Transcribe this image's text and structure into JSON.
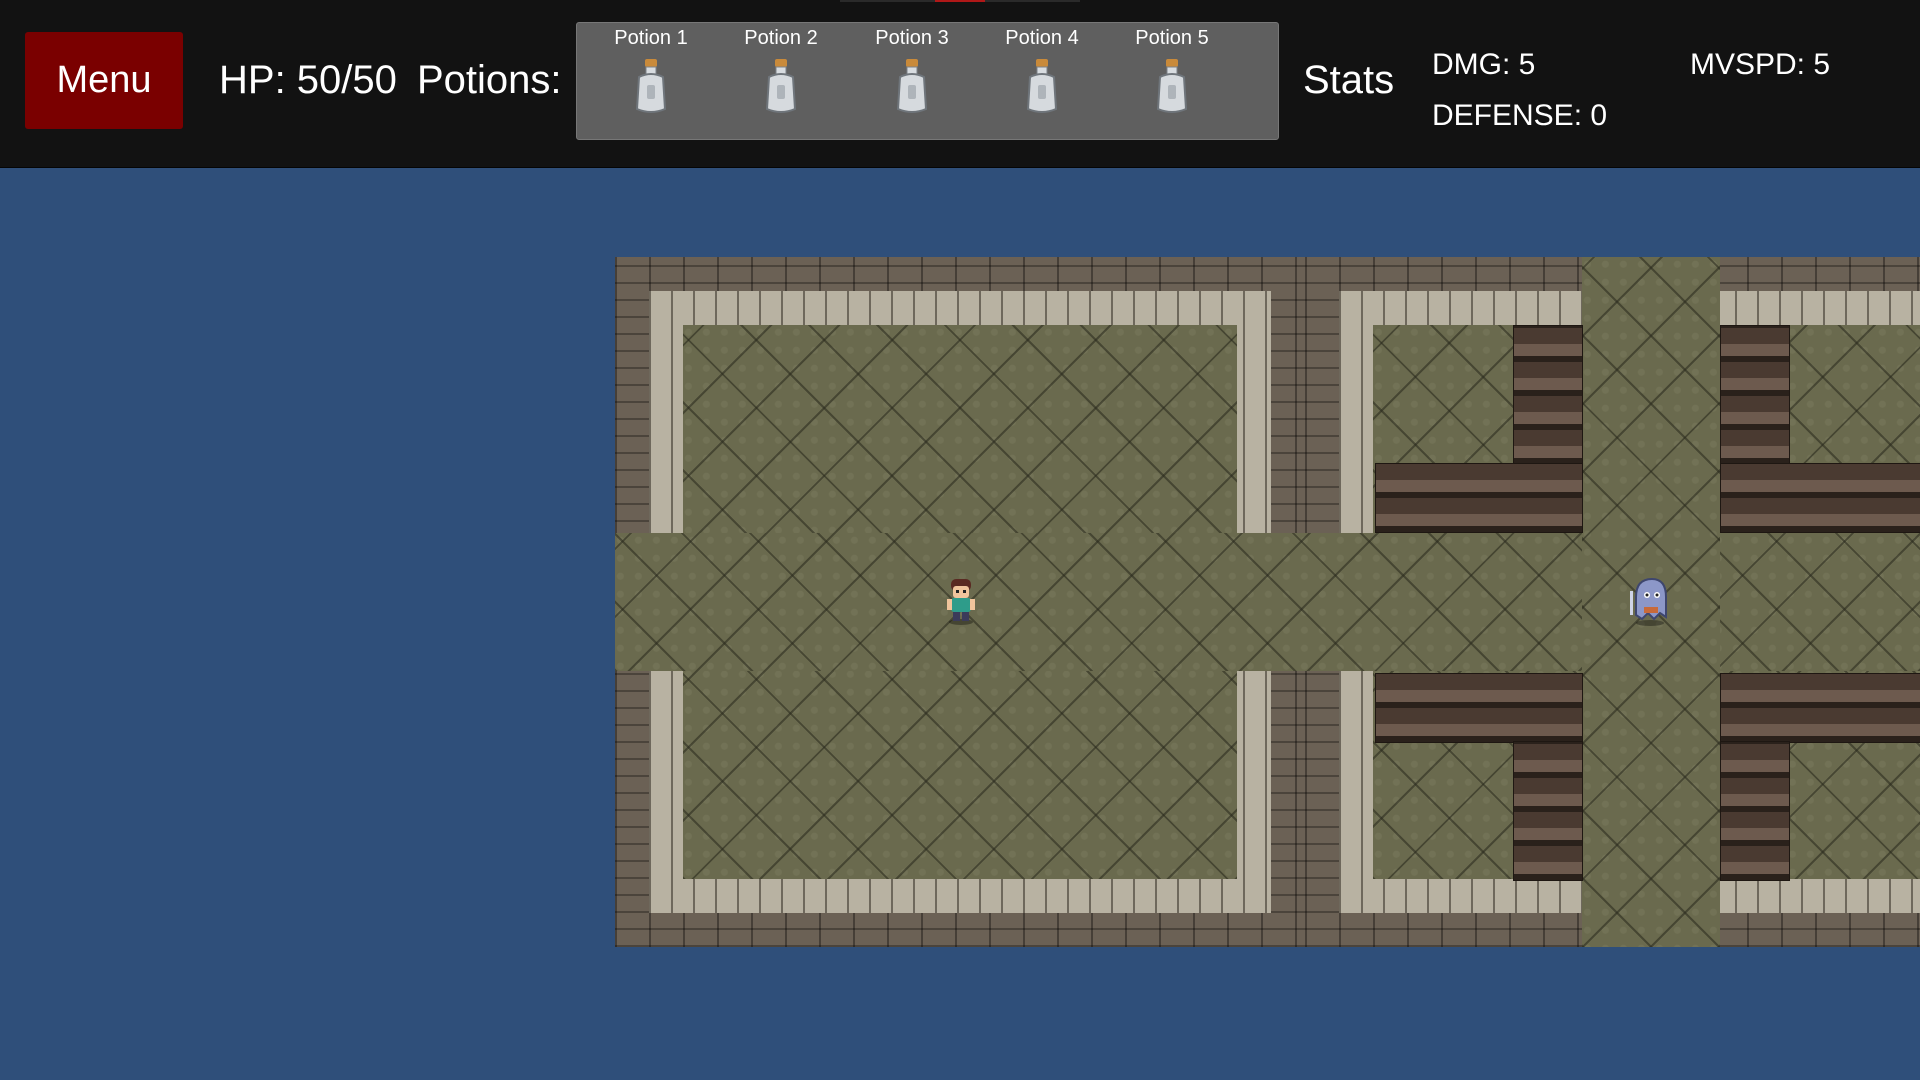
{
  "hud": {
    "menu_label": "Menu",
    "hp_text": "HP: 50/50",
    "potions_label": "Potions:",
    "potions": [
      {
        "label": "Potion 1"
      },
      {
        "label": "Potion 2"
      },
      {
        "label": "Potion 3"
      },
      {
        "label": "Potion 4"
      },
      {
        "label": "Potion 5"
      }
    ],
    "stats_label": "Stats",
    "stats": {
      "dmg": "DMG: 5",
      "mvspd": "MVSPD: 5",
      "defense": "DEFENSE: 0"
    }
  },
  "colors": {
    "hud_background": "#121212",
    "menu_button": "#7a0000",
    "potion_bar": "#5f5f5f",
    "backdrop": "#2f4f7a",
    "floor": "#6a6a4e"
  },
  "icons": {
    "potion": "potion-bottle-icon",
    "player": "player-sprite",
    "enemy": "ghost-enemy-sprite"
  }
}
